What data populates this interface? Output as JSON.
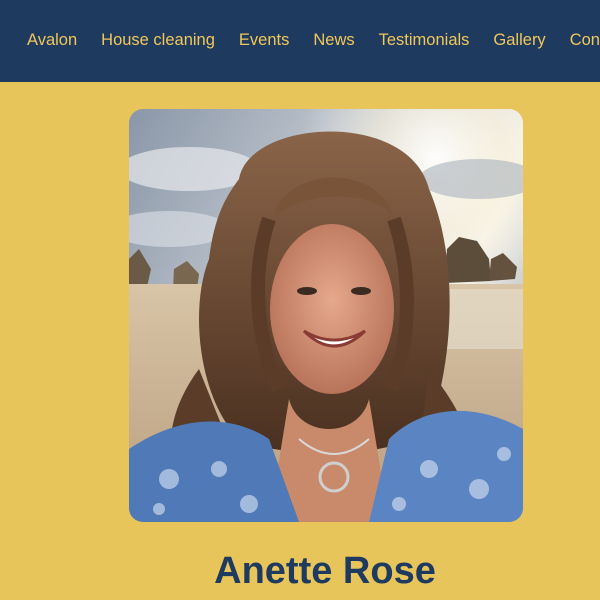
{
  "nav": {
    "items": [
      {
        "label": "Avalon"
      },
      {
        "label": "House cleaning"
      },
      {
        "label": "Events"
      },
      {
        "label": "News"
      },
      {
        "label": "Testimonials"
      },
      {
        "label": "Gallery"
      },
      {
        "label": "Con"
      }
    ]
  },
  "profile": {
    "name": "Anette Rose"
  },
  "colors": {
    "nav_background": "#1f3a5f",
    "nav_text": "#f0c75a",
    "page_background": "#e8c55a",
    "heading": "#1f3a5f"
  }
}
